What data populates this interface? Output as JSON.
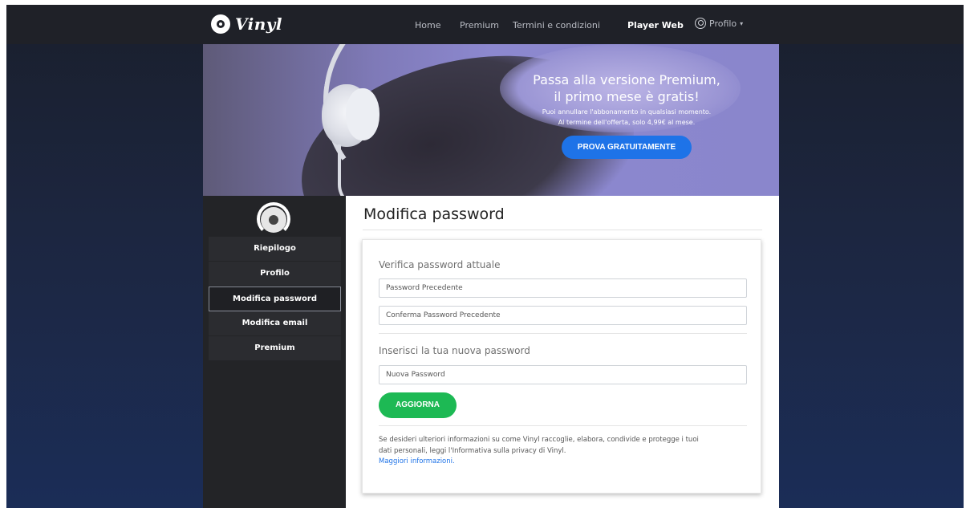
{
  "app": {
    "name": "Vinyl"
  },
  "nav": {
    "links": [
      "Home",
      "Premium",
      "Termini e condizioni"
    ],
    "active": "Player Web",
    "profile": "Profilo",
    "caret": "▾"
  },
  "banner": {
    "title_line1": "Passa alla versione Premium,",
    "title_line2": "il primo mese è gratis!",
    "sub_line1": "Puoi annullare l'abbonamento in qualsiasi momento.",
    "sub_line2": "Al termine dell'offerta, solo 4,99€ al mese.",
    "cta": "PROVA GRATUITAMENTE"
  },
  "sidebar": {
    "items": [
      {
        "label": "Riepilogo"
      },
      {
        "label": "Profilo"
      },
      {
        "label": "Modifica password"
      },
      {
        "label": "Modifica email"
      },
      {
        "label": "Premium"
      }
    ],
    "active": "Modifica password"
  },
  "main": {
    "title": "Modifica password",
    "verify_title": "Verifica password attuale",
    "old_password_placeholder": "Password Precedente",
    "confirm_password_placeholder": "Conferma Password Precedente",
    "new_title": "Inserisci la tua nuova password",
    "new_password_placeholder": "Nuova Password",
    "update_label": "AGGIORNA",
    "info_line1": "Se desideri ulteriori informazioni su come Vinyl raccoglie, elabora, condivide e protegge i tuoi",
    "info_line2": "dati personali, leggi l'Informativa sulla privacy di Vinyl.",
    "info_link": "Maggiori informazioni."
  },
  "colors": {
    "accent_green": "#1db954",
    "accent_blue": "#1e73e8",
    "navbar": "#1f2128",
    "sidebar": "#232427"
  }
}
